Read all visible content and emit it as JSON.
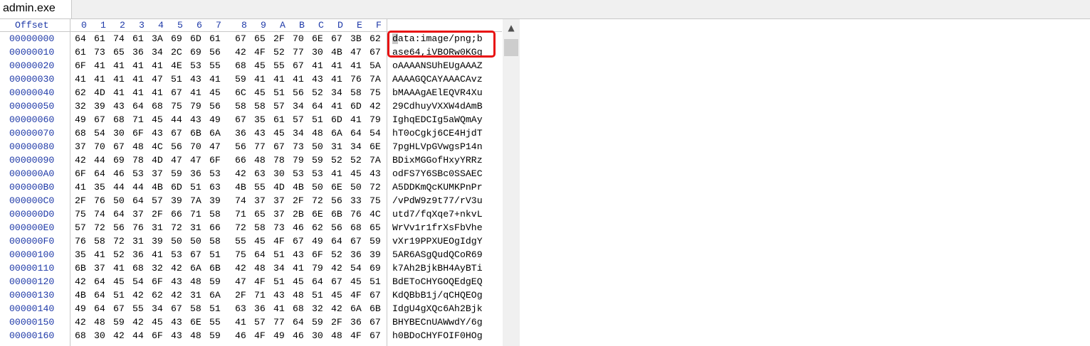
{
  "tab": {
    "title": "admin.exe"
  },
  "header": {
    "offset_label": "Offset",
    "columns": [
      "0",
      "1",
      "2",
      "3",
      "4",
      "5",
      "6",
      "7",
      "8",
      "9",
      "A",
      "B",
      "C",
      "D",
      "E",
      "F"
    ]
  },
  "rows": [
    {
      "offset": "00000000",
      "bytes": [
        "64",
        "61",
        "74",
        "61",
        "3A",
        "69",
        "6D",
        "61",
        "67",
        "65",
        "2F",
        "70",
        "6E",
        "67",
        "3B",
        "62"
      ],
      "ascii": "data:image/png;b"
    },
    {
      "offset": "00000010",
      "bytes": [
        "61",
        "73",
        "65",
        "36",
        "34",
        "2C",
        "69",
        "56",
        "42",
        "4F",
        "52",
        "77",
        "30",
        "4B",
        "47",
        "67"
      ],
      "ascii": "ase64,iVBORw0KGg"
    },
    {
      "offset": "00000020",
      "bytes": [
        "6F",
        "41",
        "41",
        "41",
        "41",
        "4E",
        "53",
        "55",
        "68",
        "45",
        "55",
        "67",
        "41",
        "41",
        "41",
        "5A"
      ],
      "ascii": "oAAAANSUhEUgAAAZ"
    },
    {
      "offset": "00000030",
      "bytes": [
        "41",
        "41",
        "41",
        "41",
        "47",
        "51",
        "43",
        "41",
        "59",
        "41",
        "41",
        "41",
        "43",
        "41",
        "76",
        "7A"
      ],
      "ascii": "AAAAGQCAYAAACAvz"
    },
    {
      "offset": "00000040",
      "bytes": [
        "62",
        "4D",
        "41",
        "41",
        "41",
        "67",
        "41",
        "45",
        "6C",
        "45",
        "51",
        "56",
        "52",
        "34",
        "58",
        "75"
      ],
      "ascii": "bMAAAgAElEQVR4Xu"
    },
    {
      "offset": "00000050",
      "bytes": [
        "32",
        "39",
        "43",
        "64",
        "68",
        "75",
        "79",
        "56",
        "58",
        "58",
        "57",
        "34",
        "64",
        "41",
        "6D",
        "42"
      ],
      "ascii": "29CdhuyVXXW4dAmB"
    },
    {
      "offset": "00000060",
      "bytes": [
        "49",
        "67",
        "68",
        "71",
        "45",
        "44",
        "43",
        "49",
        "67",
        "35",
        "61",
        "57",
        "51",
        "6D",
        "41",
        "79"
      ],
      "ascii": "IghqEDCIg5aWQmAy"
    },
    {
      "offset": "00000070",
      "bytes": [
        "68",
        "54",
        "30",
        "6F",
        "43",
        "67",
        "6B",
        "6A",
        "36",
        "43",
        "45",
        "34",
        "48",
        "6A",
        "64",
        "54"
      ],
      "ascii": "hT0oCgkj6CE4HjdT"
    },
    {
      "offset": "00000080",
      "bytes": [
        "37",
        "70",
        "67",
        "48",
        "4C",
        "56",
        "70",
        "47",
        "56",
        "77",
        "67",
        "73",
        "50",
        "31",
        "34",
        "6E"
      ],
      "ascii": "7pgHLVpGVwgsP14n"
    },
    {
      "offset": "00000090",
      "bytes": [
        "42",
        "44",
        "69",
        "78",
        "4D",
        "47",
        "47",
        "6F",
        "66",
        "48",
        "78",
        "79",
        "59",
        "52",
        "52",
        "7A"
      ],
      "ascii": "BDixMGGofHxyYRRz"
    },
    {
      "offset": "000000A0",
      "bytes": [
        "6F",
        "64",
        "46",
        "53",
        "37",
        "59",
        "36",
        "53",
        "42",
        "63",
        "30",
        "53",
        "53",
        "41",
        "45",
        "43"
      ],
      "ascii": "odFS7Y6SBc0SSAEC"
    },
    {
      "offset": "000000B0",
      "bytes": [
        "41",
        "35",
        "44",
        "44",
        "4B",
        "6D",
        "51",
        "63",
        "4B",
        "55",
        "4D",
        "4B",
        "50",
        "6E",
        "50",
        "72"
      ],
      "ascii": "A5DDKmQcKUMKPnPr"
    },
    {
      "offset": "000000C0",
      "bytes": [
        "2F",
        "76",
        "50",
        "64",
        "57",
        "39",
        "7A",
        "39",
        "74",
        "37",
        "37",
        "2F",
        "72",
        "56",
        "33",
        "75"
      ],
      "ascii": "/vPdW9z9t77/rV3u"
    },
    {
      "offset": "000000D0",
      "bytes": [
        "75",
        "74",
        "64",
        "37",
        "2F",
        "66",
        "71",
        "58",
        "71",
        "65",
        "37",
        "2B",
        "6E",
        "6B",
        "76",
        "4C"
      ],
      "ascii": "utd7/fqXqe7+nkvL"
    },
    {
      "offset": "000000E0",
      "bytes": [
        "57",
        "72",
        "56",
        "76",
        "31",
        "72",
        "31",
        "66",
        "72",
        "58",
        "73",
        "46",
        "62",
        "56",
        "68",
        "65"
      ],
      "ascii": "WrVv1r1frXsFbVhe"
    },
    {
      "offset": "000000F0",
      "bytes": [
        "76",
        "58",
        "72",
        "31",
        "39",
        "50",
        "50",
        "58",
        "55",
        "45",
        "4F",
        "67",
        "49",
        "64",
        "67",
        "59"
      ],
      "ascii": "vXr19PPXUEOgIdgY"
    },
    {
      "offset": "00000100",
      "bytes": [
        "35",
        "41",
        "52",
        "36",
        "41",
        "53",
        "67",
        "51",
        "75",
        "64",
        "51",
        "43",
        "6F",
        "52",
        "36",
        "39"
      ],
      "ascii": "5AR6ASgQudQCoR69"
    },
    {
      "offset": "00000110",
      "bytes": [
        "6B",
        "37",
        "41",
        "68",
        "32",
        "42",
        "6A",
        "6B",
        "42",
        "48",
        "34",
        "41",
        "79",
        "42",
        "54",
        "69"
      ],
      "ascii": "k7Ah2BjkBH4AyBTi"
    },
    {
      "offset": "00000120",
      "bytes": [
        "42",
        "64",
        "45",
        "54",
        "6F",
        "43",
        "48",
        "59",
        "47",
        "4F",
        "51",
        "45",
        "64",
        "67",
        "45",
        "51"
      ],
      "ascii": "BdEToCHYGOQEdgEQ"
    },
    {
      "offset": "00000130",
      "bytes": [
        "4B",
        "64",
        "51",
        "42",
        "62",
        "42",
        "31",
        "6A",
        "2F",
        "71",
        "43",
        "48",
        "51",
        "45",
        "4F",
        "67"
      ],
      "ascii": "KdQBbB1j/qCHQEOg"
    },
    {
      "offset": "00000140",
      "bytes": [
        "49",
        "64",
        "67",
        "55",
        "34",
        "67",
        "58",
        "51",
        "63",
        "36",
        "41",
        "68",
        "32",
        "42",
        "6A",
        "6B"
      ],
      "ascii": "IdgU4gXQc6Ah2Bjk"
    },
    {
      "offset": "00000150",
      "bytes": [
        "42",
        "48",
        "59",
        "42",
        "45",
        "43",
        "6E",
        "55",
        "41",
        "57",
        "77",
        "64",
        "59",
        "2F",
        "36",
        "67"
      ],
      "ascii": "BHYBECnUAWwdY/6g"
    },
    {
      "offset": "00000160",
      "bytes": [
        "68",
        "30",
        "42",
        "44",
        "6F",
        "43",
        "48",
        "59",
        "46",
        "4F",
        "49",
        "46",
        "30",
        "48",
        "4F",
        "67"
      ],
      "ascii": "h0BDoCHYFOIF0HOg"
    }
  ],
  "scrollbar": {
    "up_icon": "scroll-up-arrow"
  },
  "colors": {
    "offset_blue": "#1f3aa8",
    "highlight_red": "#e81010"
  }
}
